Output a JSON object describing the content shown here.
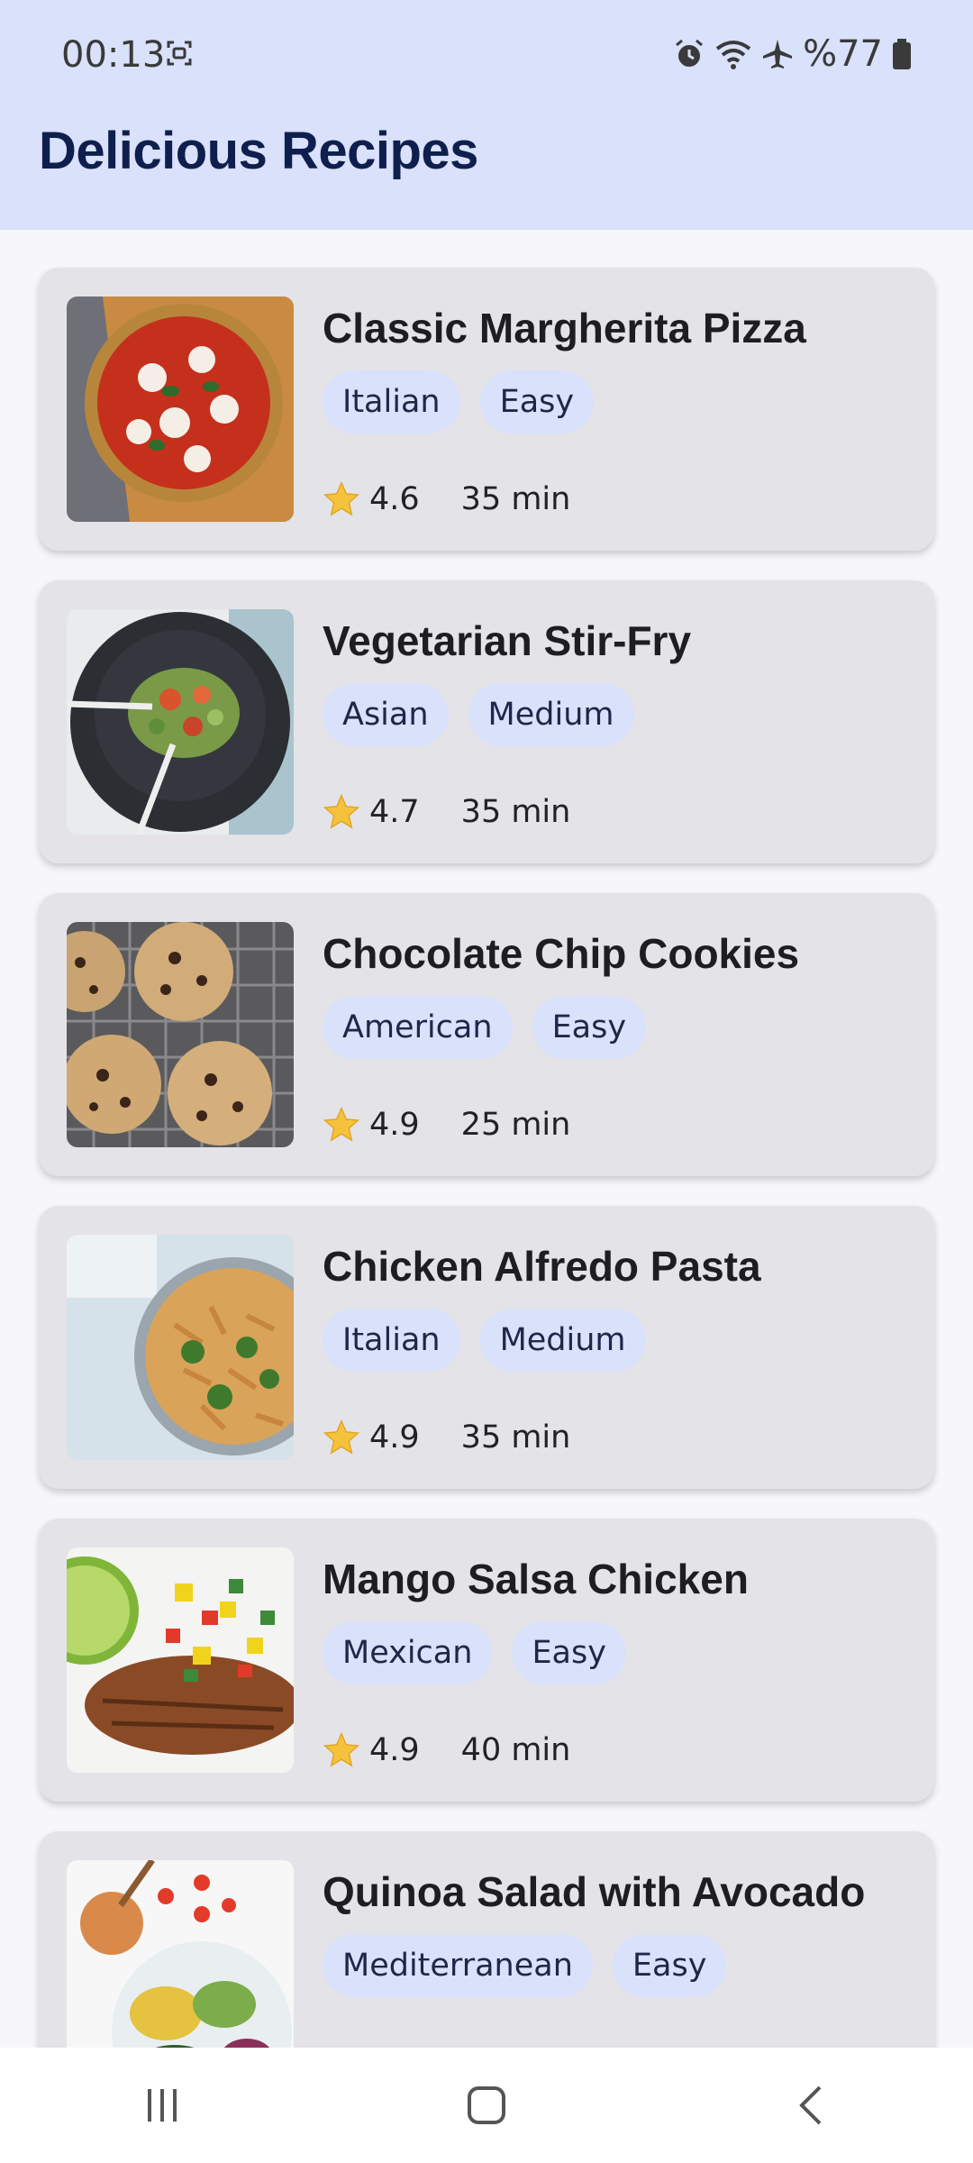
{
  "status_bar": {
    "time": "00:13",
    "battery": "%77"
  },
  "header": {
    "title": "Delicious Recipes"
  },
  "recipes": [
    {
      "name": "Classic Margherita Pizza",
      "cuisine": "Italian",
      "difficulty": "Easy",
      "rating": "4.6",
      "time": "35 min",
      "image_icon": "pizza-image"
    },
    {
      "name": "Vegetarian Stir-Fry",
      "cuisine": "Asian",
      "difficulty": "Medium",
      "rating": "4.7",
      "time": "35 min",
      "image_icon": "stir-fry-image"
    },
    {
      "name": "Chocolate Chip Cookies",
      "cuisine": "American",
      "difficulty": "Easy",
      "rating": "4.9",
      "time": "25 min",
      "image_icon": "cookies-image"
    },
    {
      "name": "Chicken Alfredo Pasta",
      "cuisine": "Italian",
      "difficulty": "Medium",
      "rating": "4.9",
      "time": "35 min",
      "image_icon": "pasta-image"
    },
    {
      "name": "Mango Salsa Chicken",
      "cuisine": "Mexican",
      "difficulty": "Easy",
      "rating": "4.9",
      "time": "40 min",
      "image_icon": "chicken-image"
    },
    {
      "name": "Quinoa Salad with Avocado",
      "cuisine": "Mediterranean",
      "difficulty": "Easy",
      "rating": "",
      "time": "",
      "image_icon": "salad-image"
    }
  ],
  "nav": {
    "icons": [
      "recent-apps-icon",
      "home-icon",
      "back-icon"
    ]
  },
  "colors": {
    "app_bar": "#d9e1fb",
    "title": "#0f1f4d",
    "card": "#e4e3e8",
    "chip": "#d9e1fb",
    "star": "#f5c33b"
  }
}
